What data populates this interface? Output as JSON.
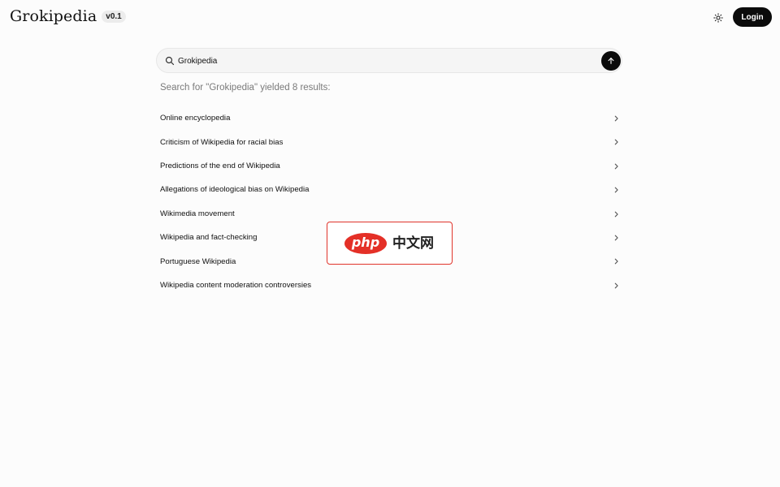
{
  "header": {
    "brand": "Grokipedia",
    "version": "v0.1",
    "theme_toggle_icon": "sun-icon",
    "login_label": "Login"
  },
  "search": {
    "value": "Grokipedia",
    "icon": "search-icon",
    "submit_icon": "arrow-up-icon",
    "summary": "Search for \"Grokipedia\" yielded 8 results:"
  },
  "results": [
    {
      "title": "Online encyclopedia"
    },
    {
      "title": "Criticism of Wikipedia for racial bias"
    },
    {
      "title": "Predictions of the end of Wikipedia"
    },
    {
      "title": "Allegations of ideological bias on Wikipedia"
    },
    {
      "title": "Wikimedia movement"
    },
    {
      "title": "Wikipedia and fact-checking"
    },
    {
      "title": "Portuguese Wikipedia"
    },
    {
      "title": "Wikipedia content moderation controversies"
    }
  ],
  "watermark": {
    "logo_text": "php",
    "site_text": "中文网"
  },
  "colors": {
    "background": "#fcfcfc",
    "primary_button": "#0b0b0b",
    "muted_text": "#7a7a7a",
    "watermark_red": "#e43027"
  }
}
